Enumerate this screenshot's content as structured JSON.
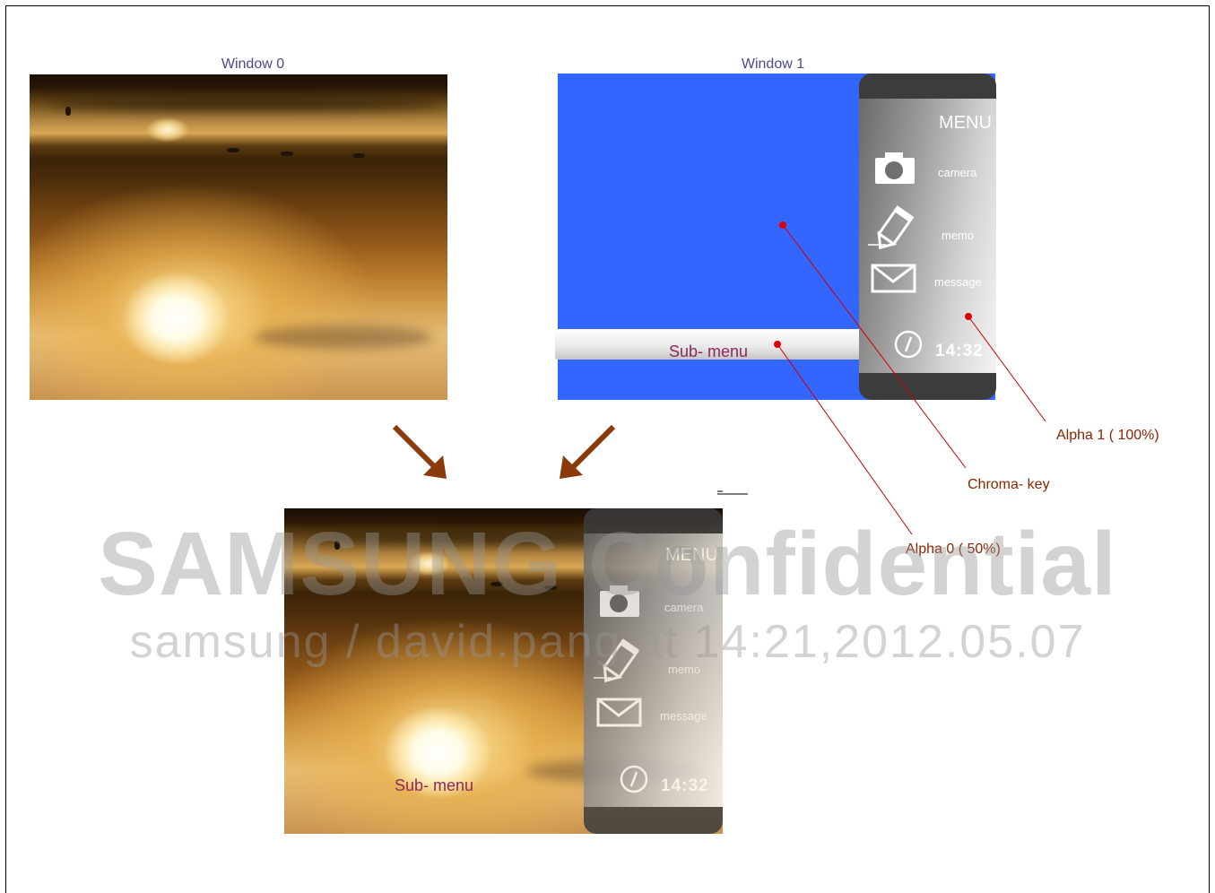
{
  "window0": {
    "title": "Window 0"
  },
  "window1": {
    "title": "Window 1",
    "submenu_label": "Sub- menu",
    "chroma_color": "#3366ff"
  },
  "device": {
    "menu_title": "MENU",
    "items": [
      {
        "label": "camera",
        "icon": "camera-icon"
      },
      {
        "label": "memo",
        "icon": "pencil-icon"
      },
      {
        "label": "message",
        "icon": "envelope-icon"
      }
    ],
    "time": "14:32",
    "clock_icon": "clock-icon"
  },
  "composite": {
    "submenu_label": "Sub- menu"
  },
  "annotations": {
    "alpha1": "Alpha 1 ( 100%)",
    "chroma": "Chroma- key",
    "alpha0": "Alpha 0 ( 50%)"
  },
  "watermark": {
    "line1": "SAMSUNG Confidential",
    "line2": "samsung / david.pang at 14:21,2012.05.07"
  },
  "colors": {
    "arrow": "#8b3a0a",
    "annotation_line": "#cc0000",
    "annotation_text": "#8b2500",
    "title_text": "#4a4a8a",
    "submenu_text": "#8a2a5a"
  }
}
